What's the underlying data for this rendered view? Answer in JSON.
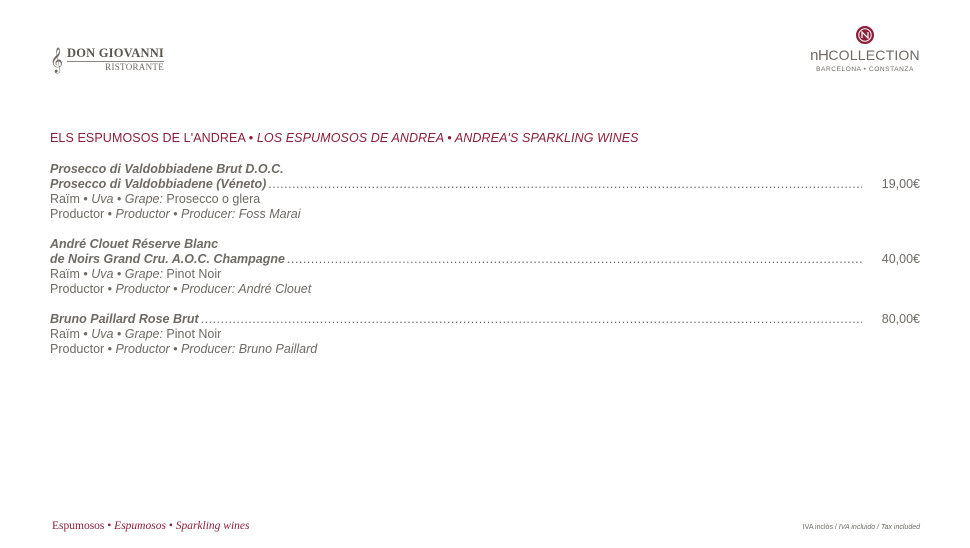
{
  "header": {
    "left_logo": {
      "clef_icon": "treble-clef-icon",
      "name": "DON GIOVANNI",
      "subtitle": "RISTORANTE"
    },
    "right_logo": {
      "mark_icon": "nh-emblem-icon",
      "brand_prefix": "nH",
      "brand_word": "COLLECTION",
      "location": "BARCELONA • CONSTANZA"
    }
  },
  "section": {
    "title_ca": "ELS ESPUMOSOS DE L'ANDREA • ",
    "title_es": "LOS ESPUMOSOS DE ANDREA • ANDREA'S SPARKLING WINES"
  },
  "labels": {
    "grape_ca": "Raïm • ",
    "grape_es_en": "Uva • Grape:",
    "producer_ca": "Productor • ",
    "producer_es_en": "Productor • Producer:"
  },
  "wines": [
    {
      "name_line1": "Prosecco di Valdobbiadene Brut D.O.C.",
      "name_line2": "Prosecco di Valdobbiadene (Véneto)",
      "price": "19,00€",
      "grape": " Prosecco o glera",
      "producer": " Foss Marai"
    },
    {
      "name_line1": "André Clouet Réserve Blanc",
      "name_line2": "de Noirs Grand Cru. A.O.C. Champagne",
      "price": "40,00€",
      "grape": " Pinot Noir",
      "producer": " André Clouet"
    },
    {
      "name_line2": "Bruno Paillard Rose Brut",
      "price": "80,00€",
      "grape": " Pinot Noir",
      "producer": " Bruno Paillard"
    }
  ],
  "footer": {
    "left_ca": "Espumosos • ",
    "left_es_en": "Espumosos • Sparkling wines",
    "right_ca": "IVA inclòs / ",
    "right_es_en": "IVA incluido / Tax included"
  },
  "colors": {
    "accent": "#8b1f3a",
    "text": "#6e6a64",
    "background": "#ffffff"
  }
}
